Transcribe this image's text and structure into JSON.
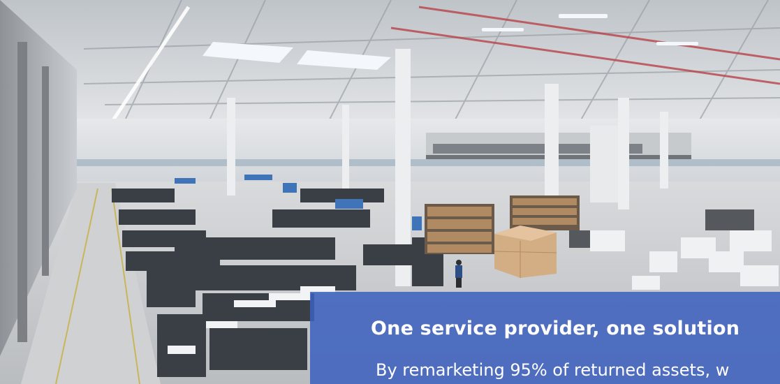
{
  "hero": {
    "image_alt": "Warehouse interior with rows of returned IT assets on pallets",
    "overlay": {
      "title": "One service provider, one solution",
      "body": "By remarketing 95% of returned assets, w",
      "background_color": "#3b60be"
    }
  }
}
